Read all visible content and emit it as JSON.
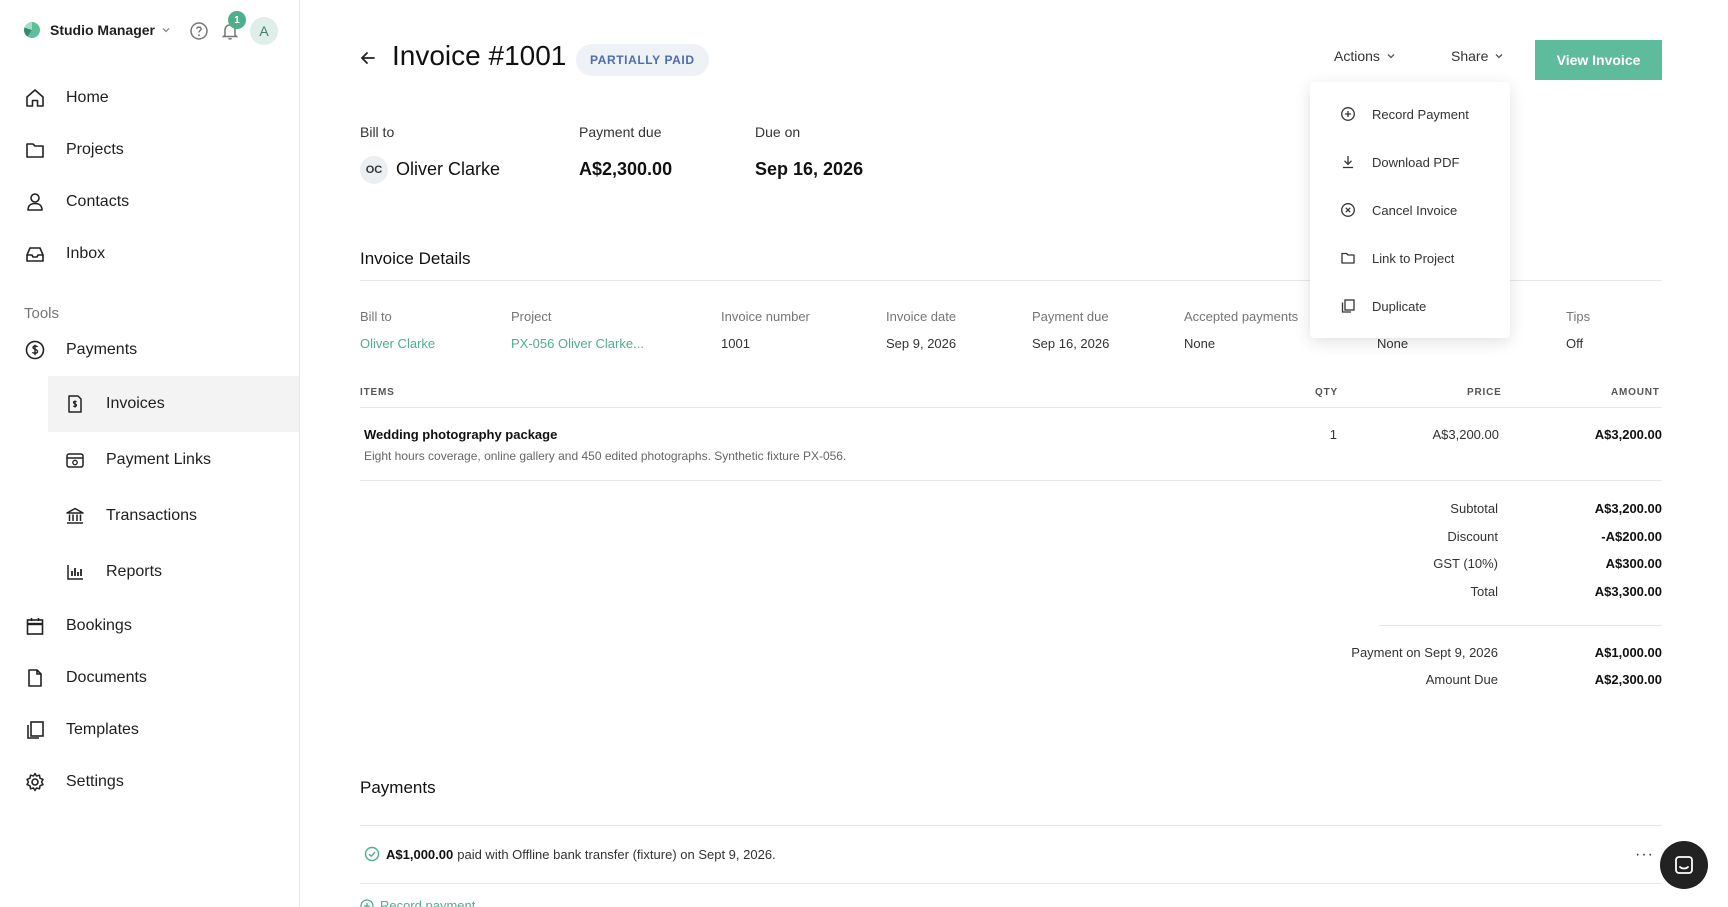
{
  "app": {
    "name": "Studio Manager",
    "notification_count": "1",
    "avatar_initial": "A"
  },
  "sidebar": {
    "items": [
      {
        "label": "Home",
        "icon": "home-icon"
      },
      {
        "label": "Projects",
        "icon": "folder-icon"
      },
      {
        "label": "Contacts",
        "icon": "person-icon"
      },
      {
        "label": "Inbox",
        "icon": "inbox-icon"
      }
    ],
    "tools_label": "Tools",
    "payments_label": "Payments",
    "payments_sub": [
      {
        "label": "Invoices",
        "icon": "invoice-icon",
        "active": true
      },
      {
        "label": "Payment Links",
        "icon": "payment-link-icon"
      },
      {
        "label": "Transactions",
        "icon": "bank-icon"
      },
      {
        "label": "Reports",
        "icon": "chart-icon"
      }
    ],
    "bottom": [
      {
        "label": "Bookings",
        "icon": "calendar-icon"
      },
      {
        "label": "Documents",
        "icon": "document-icon"
      },
      {
        "label": "Templates",
        "icon": "templates-icon"
      },
      {
        "label": "Settings",
        "icon": "gear-icon"
      }
    ]
  },
  "header": {
    "title": "Invoice #1001",
    "status": "PARTIALLY PAID",
    "actions_label": "Actions",
    "share_label": "Share",
    "view_label": "View Invoice"
  },
  "summary": {
    "bill_to_label": "Bill to",
    "client_initials": "OC",
    "client_name": "Oliver Clarke",
    "payment_due_label": "Payment due",
    "payment_due_value": "A$2,300.00",
    "due_on_label": "Due on",
    "due_on_value": "Sep 16, 2026"
  },
  "details": {
    "title": "Invoice Details",
    "fields": {
      "bill_to": {
        "label": "Bill to",
        "value": "Oliver Clarke"
      },
      "project": {
        "label": "Project",
        "value": "PX-056 Oliver Clarke..."
      },
      "invoice_number": {
        "label": "Invoice number",
        "value": "1001"
      },
      "invoice_date": {
        "label": "Invoice date",
        "value": "Sep 9, 2026"
      },
      "payment_due": {
        "label": "Payment due",
        "value": "Sep 16, 2026"
      },
      "accepted_payments": {
        "label": "Accepted payments",
        "value": "None"
      },
      "hidden_field": {
        "value": "None"
      },
      "tips": {
        "label": "Tips",
        "value": "Off"
      }
    }
  },
  "items_table": {
    "headers": {
      "items": "ITEMS",
      "qty": "QTY",
      "price": "PRICE",
      "amount": "AMOUNT"
    },
    "rows": [
      {
        "name": "Wedding photography package",
        "description": "Eight hours coverage, online gallery and 450 edited photographs. Synthetic fixture PX-056.",
        "qty": "1",
        "price": "A$3,200.00",
        "amount": "A$3,200.00"
      }
    ]
  },
  "totals": {
    "subtotal": {
      "label": "Subtotal",
      "value": "A$3,200.00"
    },
    "discount": {
      "label": "Discount",
      "value": "-A$200.00"
    },
    "gst": {
      "label": "GST (10%)",
      "value": "A$300.00"
    },
    "total": {
      "label": "Total",
      "value": "A$3,300.00"
    },
    "payment": {
      "label": "Payment on Sept 9, 2026",
      "value": "A$1,000.00"
    },
    "amount_due": {
      "label": "Amount Due",
      "value": "A$2,300.00"
    }
  },
  "payments": {
    "title": "Payments",
    "entry_amount": "A$1,000.00",
    "entry_text": "paid with Offline bank transfer (fixture) on Sept 9, 2026.",
    "more_label": "···",
    "record_label": "Record payment"
  },
  "actions_menu": {
    "items": [
      {
        "label": "Record Payment",
        "icon": "plus-circle-icon"
      },
      {
        "label": "Download PDF",
        "icon": "download-icon"
      },
      {
        "label": "Cancel Invoice",
        "icon": "x-circle-icon"
      },
      {
        "label": "Link to Project",
        "icon": "folder-icon"
      },
      {
        "label": "Duplicate",
        "icon": "duplicate-icon"
      }
    ]
  },
  "colors": {
    "accent": "#5ebb9b",
    "link": "#4fae8c",
    "status_text": "#4c6db0",
    "status_bg": "#eef1f6"
  }
}
